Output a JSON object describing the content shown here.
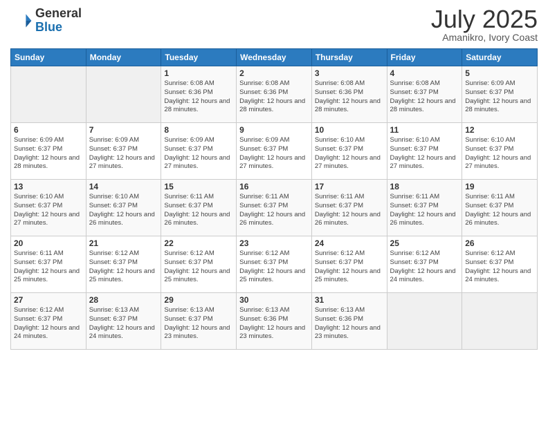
{
  "logo": {
    "general": "General",
    "blue": "Blue"
  },
  "header": {
    "month": "July 2025",
    "location": "Amanikro, Ivory Coast"
  },
  "weekdays": [
    "Sunday",
    "Monday",
    "Tuesday",
    "Wednesday",
    "Thursday",
    "Friday",
    "Saturday"
  ],
  "weeks": [
    [
      {
        "day": "",
        "info": ""
      },
      {
        "day": "",
        "info": ""
      },
      {
        "day": "1",
        "info": "Sunrise: 6:08 AM\nSunset: 6:36 PM\nDaylight: 12 hours and 28 minutes."
      },
      {
        "day": "2",
        "info": "Sunrise: 6:08 AM\nSunset: 6:36 PM\nDaylight: 12 hours and 28 minutes."
      },
      {
        "day": "3",
        "info": "Sunrise: 6:08 AM\nSunset: 6:36 PM\nDaylight: 12 hours and 28 minutes."
      },
      {
        "day": "4",
        "info": "Sunrise: 6:08 AM\nSunset: 6:37 PM\nDaylight: 12 hours and 28 minutes."
      },
      {
        "day": "5",
        "info": "Sunrise: 6:09 AM\nSunset: 6:37 PM\nDaylight: 12 hours and 28 minutes."
      }
    ],
    [
      {
        "day": "6",
        "info": "Sunrise: 6:09 AM\nSunset: 6:37 PM\nDaylight: 12 hours and 28 minutes."
      },
      {
        "day": "7",
        "info": "Sunrise: 6:09 AM\nSunset: 6:37 PM\nDaylight: 12 hours and 27 minutes."
      },
      {
        "day": "8",
        "info": "Sunrise: 6:09 AM\nSunset: 6:37 PM\nDaylight: 12 hours and 27 minutes."
      },
      {
        "day": "9",
        "info": "Sunrise: 6:09 AM\nSunset: 6:37 PM\nDaylight: 12 hours and 27 minutes."
      },
      {
        "day": "10",
        "info": "Sunrise: 6:10 AM\nSunset: 6:37 PM\nDaylight: 12 hours and 27 minutes."
      },
      {
        "day": "11",
        "info": "Sunrise: 6:10 AM\nSunset: 6:37 PM\nDaylight: 12 hours and 27 minutes."
      },
      {
        "day": "12",
        "info": "Sunrise: 6:10 AM\nSunset: 6:37 PM\nDaylight: 12 hours and 27 minutes."
      }
    ],
    [
      {
        "day": "13",
        "info": "Sunrise: 6:10 AM\nSunset: 6:37 PM\nDaylight: 12 hours and 27 minutes."
      },
      {
        "day": "14",
        "info": "Sunrise: 6:10 AM\nSunset: 6:37 PM\nDaylight: 12 hours and 26 minutes."
      },
      {
        "day": "15",
        "info": "Sunrise: 6:11 AM\nSunset: 6:37 PM\nDaylight: 12 hours and 26 minutes."
      },
      {
        "day": "16",
        "info": "Sunrise: 6:11 AM\nSunset: 6:37 PM\nDaylight: 12 hours and 26 minutes."
      },
      {
        "day": "17",
        "info": "Sunrise: 6:11 AM\nSunset: 6:37 PM\nDaylight: 12 hours and 26 minutes."
      },
      {
        "day": "18",
        "info": "Sunrise: 6:11 AM\nSunset: 6:37 PM\nDaylight: 12 hours and 26 minutes."
      },
      {
        "day": "19",
        "info": "Sunrise: 6:11 AM\nSunset: 6:37 PM\nDaylight: 12 hours and 26 minutes."
      }
    ],
    [
      {
        "day": "20",
        "info": "Sunrise: 6:11 AM\nSunset: 6:37 PM\nDaylight: 12 hours and 25 minutes."
      },
      {
        "day": "21",
        "info": "Sunrise: 6:12 AM\nSunset: 6:37 PM\nDaylight: 12 hours and 25 minutes."
      },
      {
        "day": "22",
        "info": "Sunrise: 6:12 AM\nSunset: 6:37 PM\nDaylight: 12 hours and 25 minutes."
      },
      {
        "day": "23",
        "info": "Sunrise: 6:12 AM\nSunset: 6:37 PM\nDaylight: 12 hours and 25 minutes."
      },
      {
        "day": "24",
        "info": "Sunrise: 6:12 AM\nSunset: 6:37 PM\nDaylight: 12 hours and 25 minutes."
      },
      {
        "day": "25",
        "info": "Sunrise: 6:12 AM\nSunset: 6:37 PM\nDaylight: 12 hours and 24 minutes."
      },
      {
        "day": "26",
        "info": "Sunrise: 6:12 AM\nSunset: 6:37 PM\nDaylight: 12 hours and 24 minutes."
      }
    ],
    [
      {
        "day": "27",
        "info": "Sunrise: 6:12 AM\nSunset: 6:37 PM\nDaylight: 12 hours and 24 minutes."
      },
      {
        "day": "28",
        "info": "Sunrise: 6:13 AM\nSunset: 6:37 PM\nDaylight: 12 hours and 24 minutes."
      },
      {
        "day": "29",
        "info": "Sunrise: 6:13 AM\nSunset: 6:37 PM\nDaylight: 12 hours and 23 minutes."
      },
      {
        "day": "30",
        "info": "Sunrise: 6:13 AM\nSunset: 6:36 PM\nDaylight: 12 hours and 23 minutes."
      },
      {
        "day": "31",
        "info": "Sunrise: 6:13 AM\nSunset: 6:36 PM\nDaylight: 12 hours and 23 minutes."
      },
      {
        "day": "",
        "info": ""
      },
      {
        "day": "",
        "info": ""
      }
    ]
  ]
}
